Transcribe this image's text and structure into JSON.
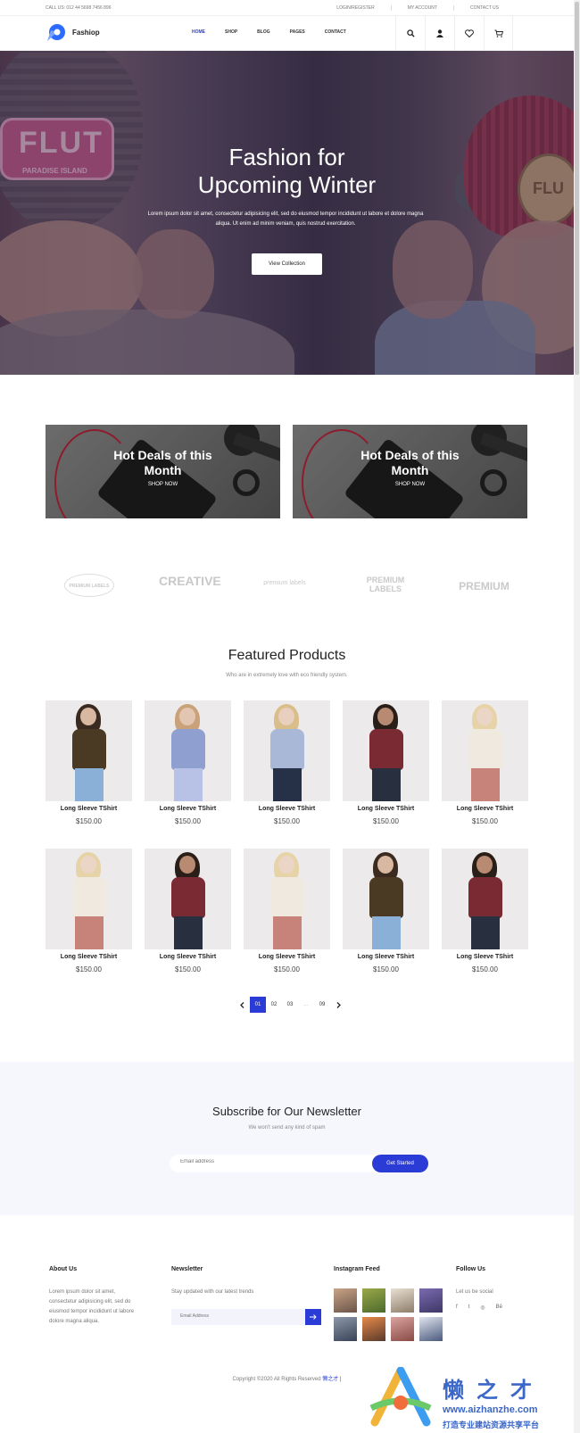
{
  "topbar": {
    "phone": "CALL US: 012 44 5698 7456 896",
    "links": [
      "LOGIN/REGISTER",
      "MY ACCOUNT",
      "CONTACT US"
    ]
  },
  "header": {
    "brand": "Fashiop",
    "nav": [
      "HOME",
      "SHOP",
      "BLOG",
      "PAGES",
      "CONTACT"
    ],
    "active_nav": "HOME",
    "icons": [
      "search-icon",
      "user-icon",
      "heart-icon",
      "cart-icon"
    ]
  },
  "hero": {
    "title_line1": "Fashion for",
    "title_line2": "Upcoming Winter",
    "text_line1": "Lorem ipsum dolor sit amet, consectetur adipisicing elit, sed do eiusmod tempor incididunt ut labore et dolore magna",
    "text_line2": "aliqua. Ut enim ad minim veniam, quis nostrud exercitation.",
    "button": "View Collection",
    "patch_text": "FLUT",
    "patch_sub": "PARADISE ISLAND",
    "badge_text": "FLU"
  },
  "deals": [
    {
      "title_line1": "Hot Deals of this",
      "title_line2": "Month",
      "cta": "SHOP NOW"
    },
    {
      "title_line1": "Hot Deals of this",
      "title_line2": "Month",
      "cta": "SHOP NOW"
    }
  ],
  "brand_logos": [
    "PREMIUM LABELS",
    "CREATIVE",
    "premium labels",
    "PREMIUM LABELS",
    "PREMIUM"
  ],
  "featured": {
    "title": "Featured Products",
    "subtitle": "Who are in extremely love with eco friendly system.",
    "products": [
      {
        "name": "Long Sleeve TShirt",
        "price": "$150.00"
      },
      {
        "name": "Long Sleeve TShirt",
        "price": "$150.00"
      },
      {
        "name": "Long Sleeve TShirt",
        "price": "$150.00"
      },
      {
        "name": "Long Sleeve TShirt",
        "price": "$150.00"
      },
      {
        "name": "Long Sleeve TShirt",
        "price": "$150.00"
      },
      {
        "name": "Long Sleeve TShirt",
        "price": "$150.00"
      },
      {
        "name": "Long Sleeve TShirt",
        "price": "$150.00"
      },
      {
        "name": "Long Sleeve TShirt",
        "price": "$150.00"
      },
      {
        "name": "Long Sleeve TShirt",
        "price": "$150.00"
      },
      {
        "name": "Long Sleeve TShirt",
        "price": "$150.00"
      }
    ]
  },
  "pagination": {
    "pages": [
      "01",
      "02",
      "03",
      "...",
      "09"
    ],
    "current": "01"
  },
  "newsletter": {
    "title": "Subscribe for Our Newsletter",
    "subtitle": "We won't send any kind of spam",
    "placeholder": "Email address",
    "button": "Get Started"
  },
  "footer": {
    "about": {
      "heading": "About Us",
      "lines": [
        "Lorem ipsum dolor sit amet,",
        "consectetur adipisicing elit, sed do",
        "eiusmod tempor incididunt ut labore",
        "dolore magna aliqua."
      ]
    },
    "newsletter": {
      "heading": "Newsletter",
      "text": "Stay updated with our latest trends",
      "placeholder": "Email Address"
    },
    "instagram": {
      "heading": "Instagram Feed"
    },
    "follow": {
      "heading": "Follow Us",
      "text": "Let us be social",
      "networks": [
        "f",
        "t",
        "◎",
        "Bē"
      ]
    },
    "copyright": "Copyright ©2020 All Rights Reserved",
    "copyright_link": "懒之才 |"
  },
  "watermark": {
    "title": "懒之才",
    "url": "www.aizhanzhe.com",
    "tagline": "打造专业建站资源共享平台"
  },
  "colors": {
    "accent": "#2b3bd6",
    "newsletter_bg": "#f6f7fd"
  }
}
